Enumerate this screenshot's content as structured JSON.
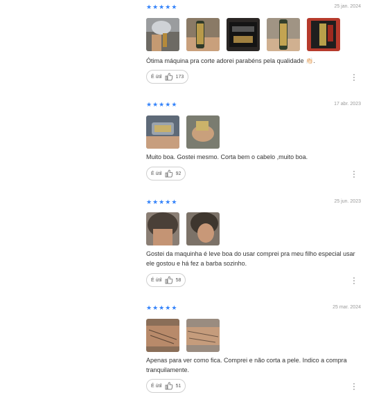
{
  "reviews": [
    {
      "rating": 5,
      "date": "25 jan. 2024",
      "text": "Ótima máquina pra corte adorei parabéns pela qualidade 👏🏻.",
      "helpful_label": "É útil",
      "helpful_count": "173",
      "photo_count": 5
    },
    {
      "rating": 5,
      "date": "17 abr. 2023",
      "text": "Muito boa. Gostei mesmo. Corta bem o cabelo ,muito boa.",
      "helpful_label": "É útil",
      "helpful_count": "92",
      "photo_count": 2
    },
    {
      "rating": 5,
      "date": "25 jun. 2023",
      "text": "Gostei da maquinha é leve boa do usar comprei pra meu filho especial usar ele gostou e há fez a barba sozinho.",
      "helpful_label": "É útil",
      "helpful_count": "58",
      "photo_count": 2
    },
    {
      "rating": 5,
      "date": "25 mar. 2024",
      "text": "Apenas para ver como fica. Comprei e não corta a pele. Indico a compra tranquilamente.",
      "helpful_label": "É útil",
      "helpful_count": "51",
      "photo_count": 2
    }
  ],
  "colors": {
    "star": "#3483fa",
    "text": "#333333",
    "date": "#999999"
  },
  "icons": {
    "star": "star-icon",
    "thumb": "thumbs-up-icon",
    "more": "more-options-icon"
  }
}
